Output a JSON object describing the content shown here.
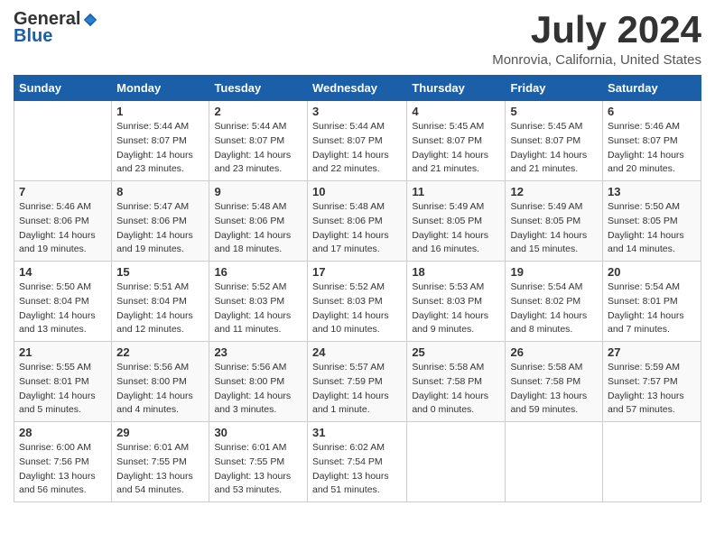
{
  "header": {
    "logo": {
      "line1": "General",
      "line2": "Blue"
    },
    "title": "July 2024",
    "location": "Monrovia, California, United States"
  },
  "weekdays": [
    "Sunday",
    "Monday",
    "Tuesday",
    "Wednesday",
    "Thursday",
    "Friday",
    "Saturday"
  ],
  "weeks": [
    [
      {
        "day": "",
        "info": ""
      },
      {
        "day": "1",
        "info": "Sunrise: 5:44 AM\nSunset: 8:07 PM\nDaylight: 14 hours\nand 23 minutes."
      },
      {
        "day": "2",
        "info": "Sunrise: 5:44 AM\nSunset: 8:07 PM\nDaylight: 14 hours\nand 23 minutes."
      },
      {
        "day": "3",
        "info": "Sunrise: 5:44 AM\nSunset: 8:07 PM\nDaylight: 14 hours\nand 22 minutes."
      },
      {
        "day": "4",
        "info": "Sunrise: 5:45 AM\nSunset: 8:07 PM\nDaylight: 14 hours\nand 21 minutes."
      },
      {
        "day": "5",
        "info": "Sunrise: 5:45 AM\nSunset: 8:07 PM\nDaylight: 14 hours\nand 21 minutes."
      },
      {
        "day": "6",
        "info": "Sunrise: 5:46 AM\nSunset: 8:07 PM\nDaylight: 14 hours\nand 20 minutes."
      }
    ],
    [
      {
        "day": "7",
        "info": "Sunrise: 5:46 AM\nSunset: 8:06 PM\nDaylight: 14 hours\nand 19 minutes."
      },
      {
        "day": "8",
        "info": "Sunrise: 5:47 AM\nSunset: 8:06 PM\nDaylight: 14 hours\nand 19 minutes."
      },
      {
        "day": "9",
        "info": "Sunrise: 5:48 AM\nSunset: 8:06 PM\nDaylight: 14 hours\nand 18 minutes."
      },
      {
        "day": "10",
        "info": "Sunrise: 5:48 AM\nSunset: 8:06 PM\nDaylight: 14 hours\nand 17 minutes."
      },
      {
        "day": "11",
        "info": "Sunrise: 5:49 AM\nSunset: 8:05 PM\nDaylight: 14 hours\nand 16 minutes."
      },
      {
        "day": "12",
        "info": "Sunrise: 5:49 AM\nSunset: 8:05 PM\nDaylight: 14 hours\nand 15 minutes."
      },
      {
        "day": "13",
        "info": "Sunrise: 5:50 AM\nSunset: 8:05 PM\nDaylight: 14 hours\nand 14 minutes."
      }
    ],
    [
      {
        "day": "14",
        "info": "Sunrise: 5:50 AM\nSunset: 8:04 PM\nDaylight: 14 hours\nand 13 minutes."
      },
      {
        "day": "15",
        "info": "Sunrise: 5:51 AM\nSunset: 8:04 PM\nDaylight: 14 hours\nand 12 minutes."
      },
      {
        "day": "16",
        "info": "Sunrise: 5:52 AM\nSunset: 8:03 PM\nDaylight: 14 hours\nand 11 minutes."
      },
      {
        "day": "17",
        "info": "Sunrise: 5:52 AM\nSunset: 8:03 PM\nDaylight: 14 hours\nand 10 minutes."
      },
      {
        "day": "18",
        "info": "Sunrise: 5:53 AM\nSunset: 8:03 PM\nDaylight: 14 hours\nand 9 minutes."
      },
      {
        "day": "19",
        "info": "Sunrise: 5:54 AM\nSunset: 8:02 PM\nDaylight: 14 hours\nand 8 minutes."
      },
      {
        "day": "20",
        "info": "Sunrise: 5:54 AM\nSunset: 8:01 PM\nDaylight: 14 hours\nand 7 minutes."
      }
    ],
    [
      {
        "day": "21",
        "info": "Sunrise: 5:55 AM\nSunset: 8:01 PM\nDaylight: 14 hours\nand 5 minutes."
      },
      {
        "day": "22",
        "info": "Sunrise: 5:56 AM\nSunset: 8:00 PM\nDaylight: 14 hours\nand 4 minutes."
      },
      {
        "day": "23",
        "info": "Sunrise: 5:56 AM\nSunset: 8:00 PM\nDaylight: 14 hours\nand 3 minutes."
      },
      {
        "day": "24",
        "info": "Sunrise: 5:57 AM\nSunset: 7:59 PM\nDaylight: 14 hours\nand 1 minute."
      },
      {
        "day": "25",
        "info": "Sunrise: 5:58 AM\nSunset: 7:58 PM\nDaylight: 14 hours\nand 0 minutes."
      },
      {
        "day": "26",
        "info": "Sunrise: 5:58 AM\nSunset: 7:58 PM\nDaylight: 13 hours\nand 59 minutes."
      },
      {
        "day": "27",
        "info": "Sunrise: 5:59 AM\nSunset: 7:57 PM\nDaylight: 13 hours\nand 57 minutes."
      }
    ],
    [
      {
        "day": "28",
        "info": "Sunrise: 6:00 AM\nSunset: 7:56 PM\nDaylight: 13 hours\nand 56 minutes."
      },
      {
        "day": "29",
        "info": "Sunrise: 6:01 AM\nSunset: 7:55 PM\nDaylight: 13 hours\nand 54 minutes."
      },
      {
        "day": "30",
        "info": "Sunrise: 6:01 AM\nSunset: 7:55 PM\nDaylight: 13 hours\nand 53 minutes."
      },
      {
        "day": "31",
        "info": "Sunrise: 6:02 AM\nSunset: 7:54 PM\nDaylight: 13 hours\nand 51 minutes."
      },
      {
        "day": "",
        "info": ""
      },
      {
        "day": "",
        "info": ""
      },
      {
        "day": "",
        "info": ""
      }
    ]
  ]
}
